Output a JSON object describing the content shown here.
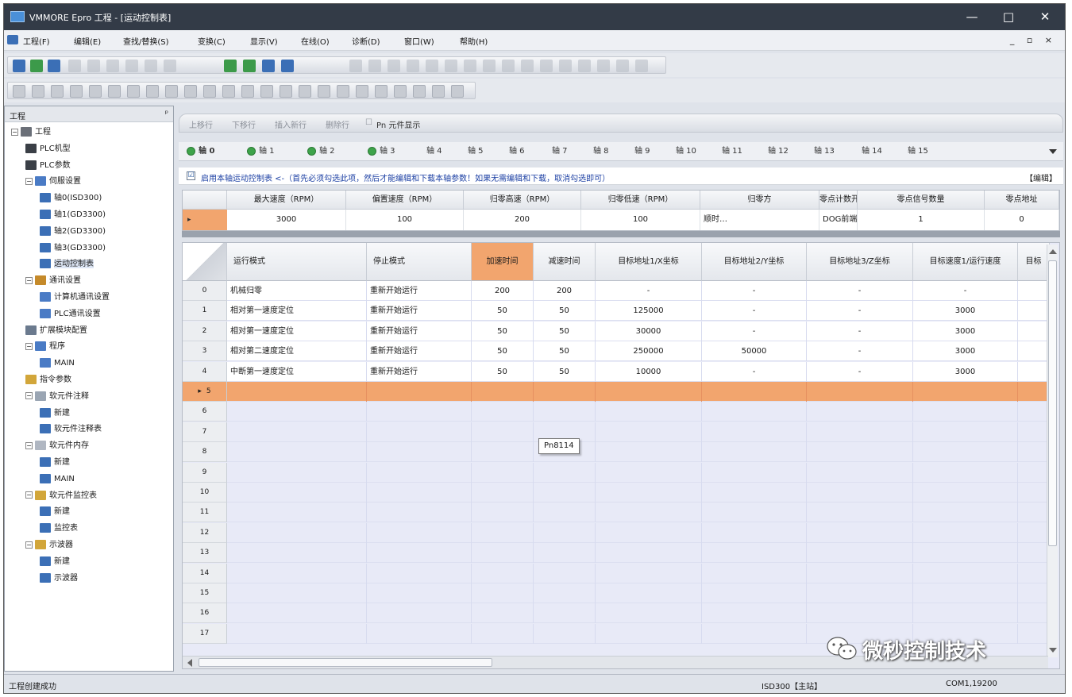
{
  "window": {
    "title": "VMMORE Epro 工程 - [运动控制表]",
    "minimize": "—",
    "maximize": "□",
    "close": "✕"
  },
  "menu": [
    "工程(F)",
    "编辑(E)",
    "查找/替换(S)",
    "变换(C)",
    "显示(V)",
    "在线(O)",
    "诊断(D)",
    "窗口(W)",
    "帮助(H)"
  ],
  "mdi_controls": "_ ▫ ×",
  "left_panel": {
    "title": "工程",
    "pin": "ᵖ"
  },
  "tree": [
    {
      "label": "工程",
      "level": 0,
      "icon": "project-icon",
      "expander": "−",
      "color": "#6a6f78"
    },
    {
      "label": "PLC机型",
      "level": 1,
      "icon": "plc-icon",
      "color": "#3a3f46"
    },
    {
      "label": "PLC参数",
      "level": 1,
      "icon": "plc-icon",
      "color": "#3a3f46"
    },
    {
      "label": "伺服设置",
      "level": 1,
      "icon": "servo-icon",
      "expander": "−",
      "color": "#4a7bc5"
    },
    {
      "label": "轴0(ISD300)",
      "level": 2,
      "icon": "axis-icon",
      "color": "#3b6fb6"
    },
    {
      "label": "轴1(GD3300)",
      "level": 2,
      "icon": "axis-icon",
      "color": "#3b6fb6"
    },
    {
      "label": "轴2(GD3300)",
      "level": 2,
      "icon": "axis-icon",
      "color": "#3b6fb6"
    },
    {
      "label": "轴3(GD3300)",
      "level": 2,
      "icon": "axis-icon",
      "color": "#3b6fb6"
    },
    {
      "label": "运动控制表",
      "level": 2,
      "icon": "table-icon",
      "color": "#3b6fb6",
      "selected": true
    },
    {
      "label": "通讯设置",
      "level": 1,
      "icon": "comm-icon",
      "expander": "−",
      "color": "#c58a2a"
    },
    {
      "label": "计算机通讯设置",
      "level": 2,
      "icon": "pc-comm-icon",
      "color": "#4a7bc5"
    },
    {
      "label": "PLC通讯设置",
      "level": 2,
      "icon": "plc-comm-icon",
      "color": "#4a7bc5"
    },
    {
      "label": "扩展模块配置",
      "level": 1,
      "icon": "module-icon",
      "color": "#6b7a8e"
    },
    {
      "label": "程序",
      "level": 1,
      "icon": "program-icon",
      "expander": "−",
      "color": "#4a7bc5"
    },
    {
      "label": "MAIN",
      "level": 2,
      "icon": "main-icon",
      "color": "#4a7bc5"
    },
    {
      "label": "指令参数",
      "level": 1,
      "icon": "instr-icon",
      "color": "#d2a63a"
    },
    {
      "label": "软元件注释",
      "level": 1,
      "icon": "comment-icon",
      "expander": "−",
      "color": "#9aa5b3"
    },
    {
      "label": "新建",
      "level": 2,
      "icon": "new-icon",
      "color": "#3b6fb6"
    },
    {
      "label": "软元件注释表",
      "level": 2,
      "icon": "sheet-icon",
      "color": "#3b6fb6"
    },
    {
      "label": "软元件内存",
      "level": 1,
      "icon": "memory-icon",
      "expander": "−",
      "color": "#b0b7c2"
    },
    {
      "label": "新建",
      "level": 2,
      "icon": "new-icon",
      "color": "#3b6fb6"
    },
    {
      "label": "MAIN",
      "level": 2,
      "icon": "main-icon",
      "color": "#3b6fb6"
    },
    {
      "label": "软元件监控表",
      "level": 1,
      "icon": "monitor-icon",
      "expander": "−",
      "color": "#d2a63a"
    },
    {
      "label": "新建",
      "level": 2,
      "icon": "new-icon",
      "color": "#3b6fb6"
    },
    {
      "label": "监控表",
      "level": 2,
      "icon": "sheet-icon",
      "color": "#3b6fb6"
    },
    {
      "label": "示波器",
      "level": 1,
      "icon": "scope-icon",
      "expander": "−",
      "color": "#d2a63a"
    },
    {
      "label": "新建",
      "level": 2,
      "icon": "new-icon",
      "color": "#3b6fb6"
    },
    {
      "label": "示波器",
      "level": 2,
      "icon": "sheet-icon",
      "color": "#3b6fb6"
    }
  ],
  "row_toolbar": {
    "move_up": "上移行",
    "move_down": "下移行",
    "insert": "插入新行",
    "delete": "删除行",
    "pn_display": "Pn 元件显示",
    "checkbox": "☐"
  },
  "axis_tabs": [
    {
      "label": "轴 0",
      "led": true,
      "active": true
    },
    {
      "label": "轴 1",
      "led": true
    },
    {
      "label": "轴 2",
      "led": true
    },
    {
      "label": "轴 3",
      "led": true
    },
    {
      "label": "轴 4"
    },
    {
      "label": "轴 5"
    },
    {
      "label": "轴 6"
    },
    {
      "label": "轴 7"
    },
    {
      "label": "轴 8"
    },
    {
      "label": "轴 9"
    },
    {
      "label": "轴 10"
    },
    {
      "label": "轴 11"
    },
    {
      "label": "轴 12"
    },
    {
      "label": "轴 13"
    },
    {
      "label": "轴 14"
    },
    {
      "label": "轴 15"
    }
  ],
  "enable": {
    "checked": "☑",
    "text": "启用本轴运动控制表 <-（首先必须勾选此项，然后才能编辑和下载本轴参数！如果无需编辑和下载，取消勾选即可）",
    "edit": "【编辑】"
  },
  "param_table": {
    "headers": [
      "最大速度（RPM）",
      "偏置速度（RPM）",
      "归零高速（RPM）",
      "归零低速（RPM）",
      "归零方",
      "零点计数开始位置",
      "零点信号数量",
      "零点地址"
    ],
    "row_indicator": "▸",
    "values": [
      "3000",
      "100",
      "200",
      "100",
      "顺时…",
      "DOG前端",
      "1",
      "0"
    ]
  },
  "motion_table": {
    "headers": [
      "运行模式",
      "停止模式",
      "加速时间",
      "减速时间",
      "目标地址1/X坐标",
      "目标地址2/Y坐标",
      "目标地址3/Z坐标",
      "目标速度1/运行速度",
      "目标"
    ],
    "rows": [
      {
        "idx": "0",
        "cells": [
          "机械归零",
          "重新开始运行",
          "200",
          "200",
          "-",
          "-",
          "-",
          "-",
          ""
        ]
      },
      {
        "idx": "1",
        "cells": [
          "相对第一速度定位",
          "重新开始运行",
          "50",
          "50",
          "125000",
          "-",
          "-",
          "3000",
          ""
        ]
      },
      {
        "idx": "2",
        "cells": [
          "相对第一速度定位",
          "重新开始运行",
          "50",
          "50",
          "30000",
          "-",
          "-",
          "3000",
          ""
        ]
      },
      {
        "idx": "3",
        "cells": [
          "相对第二速度定位",
          "重新开始运行",
          "50",
          "50",
          "250000",
          "50000",
          "-",
          "3000",
          ""
        ]
      },
      {
        "idx": "4",
        "cells": [
          "中断第一速度定位",
          "重新开始运行",
          "50",
          "50",
          "10000",
          "-",
          "-",
          "3000",
          ""
        ]
      }
    ],
    "selected_row": {
      "idx": "5",
      "marker": "▸"
    },
    "empty_rows": [
      "6",
      "7",
      "8",
      "9",
      "10",
      "11",
      "12",
      "13",
      "14",
      "15",
      "16",
      "17"
    ]
  },
  "tooltip": "Pn8114",
  "status": {
    "left": "工程创建成功",
    "device": "ISD300【主站】",
    "port": "COM1,19200"
  },
  "watermark": "微秒控制技术",
  "colors": {
    "accent_orange": "#f2a56e",
    "empty_row": "#e8eaf7",
    "title_bar": "#333b47"
  }
}
